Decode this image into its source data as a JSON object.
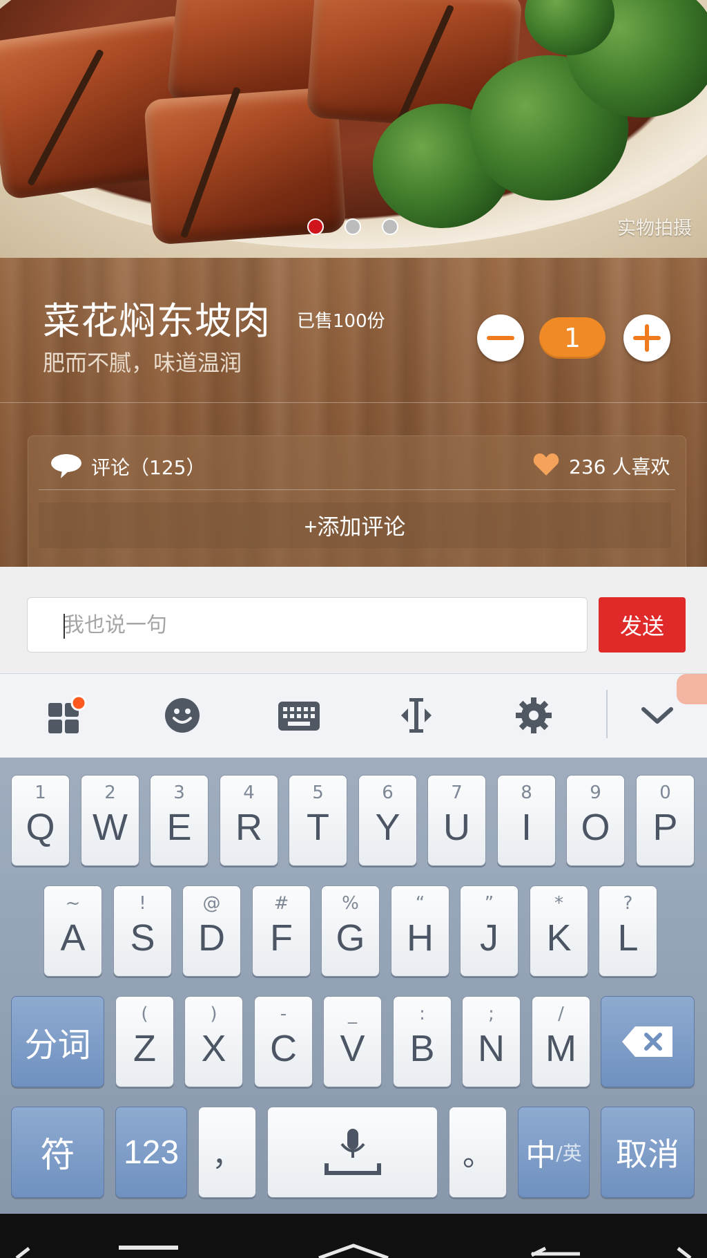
{
  "hero": {
    "photo_note": "实物拍摄",
    "carousel": {
      "count": 3,
      "active_index": 0
    }
  },
  "dish": {
    "name": "菜花焖东坡肉",
    "sold": "已售100份",
    "description": "肥而不腻，味道温润",
    "quantity": "1"
  },
  "comments": {
    "label": "评论（125）",
    "likes": "236 人喜欢",
    "add_label": "+添加评论"
  },
  "input": {
    "placeholder": "我也说一句",
    "value": "",
    "send_label": "发送"
  },
  "ime_toolbar": {
    "icons": [
      "apps-icon",
      "emoji-icon",
      "keyboard-icon",
      "cursor-move-icon",
      "settings-icon",
      "hide-keyboard-icon"
    ]
  },
  "keyboard": {
    "row1": [
      {
        "main": "Q",
        "sub": "1"
      },
      {
        "main": "W",
        "sub": "2"
      },
      {
        "main": "E",
        "sub": "3"
      },
      {
        "main": "R",
        "sub": "4"
      },
      {
        "main": "T",
        "sub": "5"
      },
      {
        "main": "Y",
        "sub": "6"
      },
      {
        "main": "U",
        "sub": "7"
      },
      {
        "main": "I",
        "sub": "8"
      },
      {
        "main": "O",
        "sub": "9"
      },
      {
        "main": "P",
        "sub": "0"
      }
    ],
    "row2": [
      {
        "main": "A",
        "sub": "~"
      },
      {
        "main": "S",
        "sub": "!"
      },
      {
        "main": "D",
        "sub": "@"
      },
      {
        "main": "F",
        "sub": "#"
      },
      {
        "main": "G",
        "sub": "%"
      },
      {
        "main": "H",
        "sub": "“"
      },
      {
        "main": "J",
        "sub": "”"
      },
      {
        "main": "K",
        "sub": "*"
      },
      {
        "main": "L",
        "sub": "?"
      }
    ],
    "row3_left": "分词",
    "row3": [
      {
        "main": "Z",
        "sub": "("
      },
      {
        "main": "X",
        "sub": ")"
      },
      {
        "main": "C",
        "sub": "-"
      },
      {
        "main": "V",
        "sub": "_"
      },
      {
        "main": "B",
        "sub": ":"
      },
      {
        "main": "N",
        "sub": ";"
      },
      {
        "main": "M",
        "sub": "/"
      }
    ],
    "row4": {
      "symbol": "符",
      "numbers": "123",
      "comma": "，",
      "period": "。",
      "lang_main": "中",
      "lang_sub": "/英",
      "cancel": "取消"
    }
  },
  "colors": {
    "accent_orange": "#f08a26",
    "send_red": "#e02a2a",
    "carousel_active": "#d0141b"
  }
}
